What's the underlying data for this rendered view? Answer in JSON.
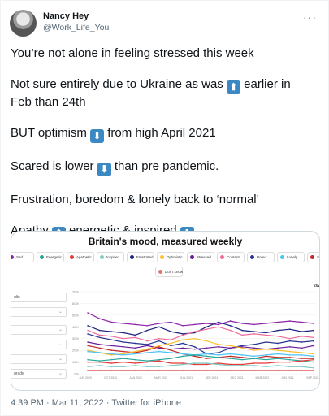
{
  "author": {
    "name": "Nancy Hey",
    "handle": "@Work_Life_You"
  },
  "tweet_lines": [
    "You’re not alone in feeling stressed this week",
    "Not sure entirely due to Ukraine as was ⬆️ earlier in Feb than 24th",
    "BUT optimism ⬇️ from high April 2021",
    "Scared is lower ⬇️ than pre pandemic.",
    "Frustration, boredom & lonely  back to ‘normal’",
    "Apathy ⬆️ energetic & inspired ⬇️"
  ],
  "tweet": {
    "l1": "You’re not alone in feeling stressed this week",
    "l2a": "Not sure entirely due to Ukraine as was",
    "l2b": "earlier in",
    "l2c": "Feb than 24th",
    "l3a": "BUT optimism",
    "l3b": "from high April 2021",
    "l4a": "Scared is lower",
    "l4b": "than pre pandemic.",
    "l5": "Frustration, boredom & lonely  back to ‘normal’",
    "l6a": "Apathy",
    "l6b": "energetic & inspired"
  },
  "chart": {
    "title": "Britain's mood, measured weekly",
    "legend": [
      {
        "label": "Sad",
        "color": "#8e24aa"
      },
      {
        "label": "Energetic",
        "color": "#26a69a"
      },
      {
        "label": "Apathetic",
        "color": "#e53935"
      },
      {
        "label": "Inspired",
        "color": "#80cbc4"
      },
      {
        "label": "Frustrated",
        "color": "#1a237e"
      },
      {
        "label": "Optimistic",
        "color": "#fbc02d"
      },
      {
        "label": "Stressed",
        "color": "#6a1b9a"
      },
      {
        "label": "Content",
        "color": "#ef6c9a"
      },
      {
        "label": "Bored",
        "color": "#283593"
      },
      {
        "label": "Lonely",
        "color": "#4fc3f7"
      },
      {
        "label": "Scared",
        "color": "#c62828"
      },
      {
        "label": "Don't know",
        "color": "#e57373"
      }
    ],
    "sidebar_labels": [
      "ults",
      "",
      "",
      "",
      "",
      "grade"
    ],
    "partial_label": "202",
    "y_ticks": [
      "70%",
      "60%",
      "50%",
      "40%",
      "30%",
      "20%",
      "10%",
      "0%"
    ],
    "x_ticks": [
      "JUN 2020",
      "OCT 2020",
      "JAN 2021",
      "MAR 2021",
      "JUN 2021",
      "SEP 2021",
      "DEC 2021",
      "MAR 2022",
      "JUN 2021",
      "SEP 2021"
    ]
  },
  "chart_data": {
    "type": "line",
    "title": "Britain's mood, measured weekly",
    "ylim": [
      0,
      70
    ],
    "series": [
      {
        "name": "Stressed",
        "color": "#8e24aa",
        "values": [
          52,
          47,
          44,
          43,
          42,
          41,
          43,
          44,
          41,
          42,
          43,
          42,
          45,
          43,
          42,
          43,
          44,
          45,
          44,
          43
        ]
      },
      {
        "name": "Frustrated",
        "color": "#1a237e",
        "values": [
          41,
          37,
          36,
          35,
          33,
          37,
          40,
          36,
          34,
          35,
          40,
          44,
          41,
          37,
          36,
          35,
          37,
          38,
          36,
          37
        ]
      },
      {
        "name": "Content",
        "color": "#ef6c9a",
        "values": [
          37,
          33,
          32,
          30,
          31,
          28,
          30,
          29,
          33,
          36,
          38,
          40,
          37,
          33,
          34,
          33,
          32,
          30,
          32,
          31
        ]
      },
      {
        "name": "Bored",
        "color": "#283593",
        "values": [
          34,
          31,
          29,
          27,
          26,
          25,
          28,
          24,
          26,
          23,
          17,
          18,
          22,
          24,
          25,
          27,
          26,
          28,
          27,
          28
        ]
      },
      {
        "name": "Sad",
        "color": "#6a1b9a",
        "values": [
          27,
          25,
          24,
          23,
          22,
          24,
          22,
          21,
          22,
          21,
          22,
          23,
          22,
          23,
          22,
          21,
          22,
          23,
          22,
          24
        ]
      },
      {
        "name": "Scared",
        "color": "#c62828",
        "values": [
          24,
          22,
          20,
          19,
          18,
          20,
          23,
          20,
          17,
          15,
          13,
          14,
          15,
          14,
          13,
          15,
          14,
          14,
          13,
          13
        ]
      },
      {
        "name": "Optimistic",
        "color": "#fbc02d",
        "values": [
          20,
          18,
          16,
          17,
          19,
          21,
          24,
          26,
          29,
          30,
          28,
          25,
          24,
          22,
          20,
          21,
          20,
          19,
          18,
          17
        ]
      },
      {
        "name": "Lonely",
        "color": "#4fc3f7",
        "values": [
          19,
          18,
          17,
          16,
          17,
          18,
          19,
          18,
          17,
          16,
          17,
          16,
          17,
          16,
          15,
          16,
          17,
          16,
          16,
          15
        ]
      },
      {
        "name": "Energetic",
        "color": "#26a69a",
        "values": [
          12,
          11,
          12,
          13,
          12,
          11,
          12,
          13,
          15,
          16,
          15,
          14,
          13,
          12,
          13,
          12,
          13,
          12,
          11,
          10
        ]
      },
      {
        "name": "Apathetic",
        "color": "#e53935",
        "values": [
          10,
          10,
          9,
          10,
          9,
          10,
          11,
          9,
          9,
          8,
          8,
          9,
          8,
          8,
          9,
          9,
          10,
          10,
          11,
          12
        ]
      },
      {
        "name": "Inspired",
        "color": "#80cbc4",
        "values": [
          6,
          7,
          6,
          6,
          7,
          6,
          6,
          7,
          8,
          9,
          9,
          8,
          7,
          7,
          7,
          6,
          7,
          6,
          6,
          5
        ]
      },
      {
        "name": "Don't know",
        "color": "#e57373",
        "values": [
          3,
          3,
          3,
          3,
          3,
          3,
          3,
          3,
          3,
          3,
          3,
          3,
          3,
          3,
          3,
          3,
          3,
          3,
          3,
          3
        ]
      }
    ]
  },
  "footer": {
    "time": "4:39 PM",
    "sep1": " · ",
    "date": "Mar 11, 2022",
    "sep2": " · ",
    "source": "Twitter for iPhone"
  }
}
